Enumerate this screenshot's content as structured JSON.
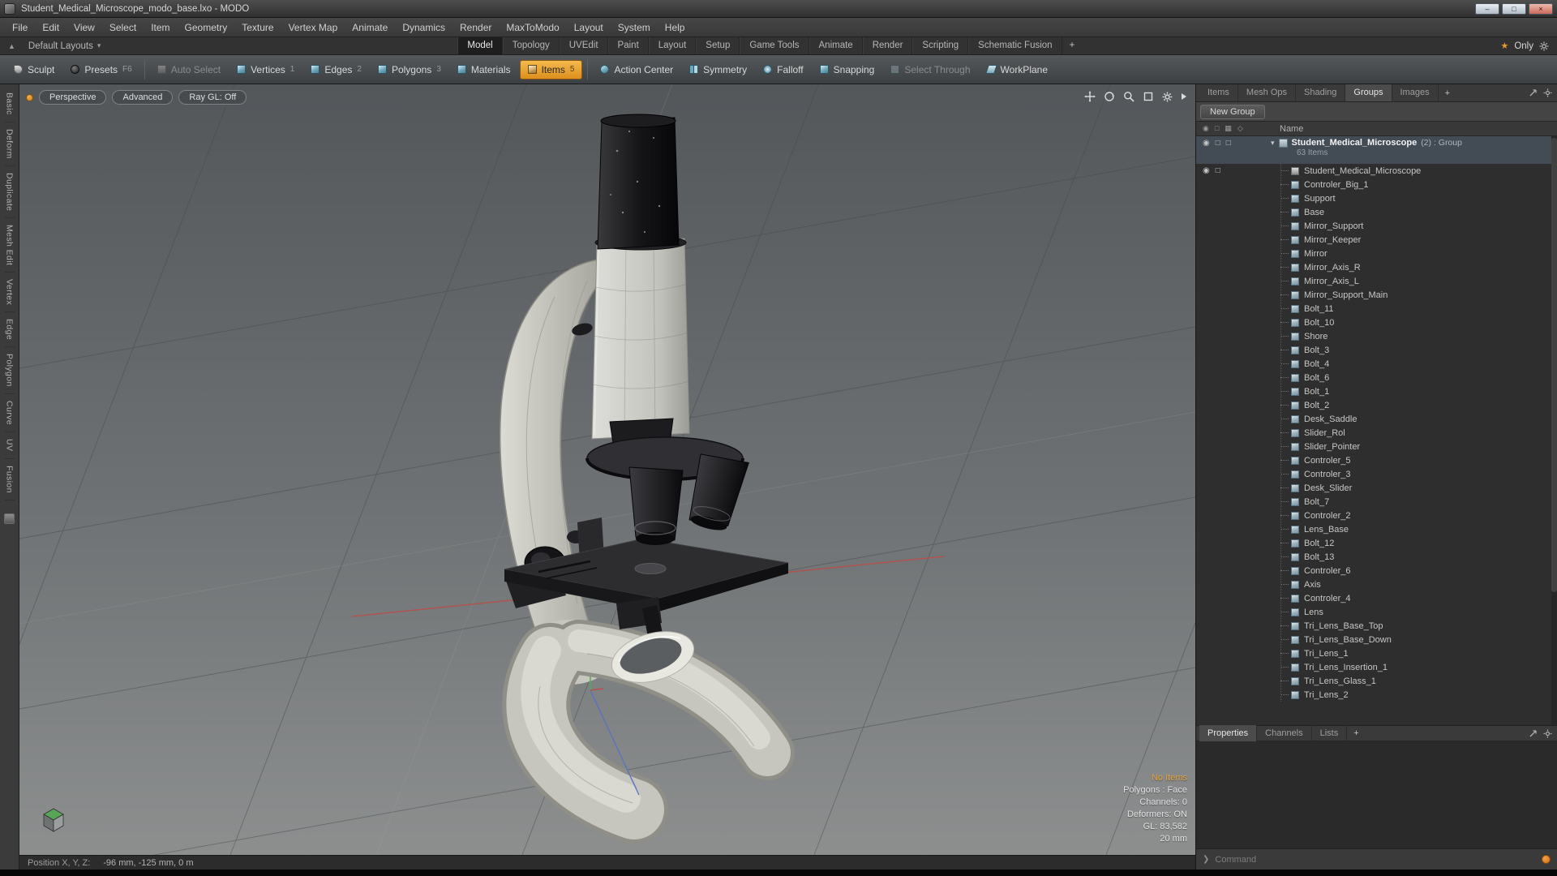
{
  "window": {
    "title": "Student_Medical_Microscope_modo_base.lxo - MODO",
    "controls": {
      "minimize": "–",
      "maximize": "□",
      "close": "×"
    }
  },
  "menu_bar": {
    "items": [
      {
        "label": "File"
      },
      {
        "label": "Edit"
      },
      {
        "label": "View"
      },
      {
        "label": "Select"
      },
      {
        "label": "Item"
      },
      {
        "label": "Geometry"
      },
      {
        "label": "Texture"
      },
      {
        "label": "Vertex Map"
      },
      {
        "label": "Animate"
      },
      {
        "label": "Dynamics"
      },
      {
        "label": "Render"
      },
      {
        "label": "MaxToModo"
      },
      {
        "label": "Layout"
      },
      {
        "label": "System"
      },
      {
        "label": "Help"
      }
    ]
  },
  "layout_bar": {
    "dock_icon": "▲",
    "layout_switcher": "Default Layouts",
    "caret": "▾",
    "tabs": [
      {
        "label": "Model",
        "active": true
      },
      {
        "label": "Topology"
      },
      {
        "label": "UVEdit"
      },
      {
        "label": "Paint"
      },
      {
        "label": "Layout"
      },
      {
        "label": "Setup"
      },
      {
        "label": "Game Tools"
      },
      {
        "label": "Animate"
      },
      {
        "label": "Render"
      },
      {
        "label": "Scripting"
      },
      {
        "label": "Schematic Fusion"
      }
    ],
    "add_tab": "+",
    "only_toggle": {
      "star": "★",
      "label": "Only"
    }
  },
  "toolbar": {
    "group1": [
      {
        "label": "Sculpt",
        "icon": "sculpt"
      },
      {
        "label": "Presets",
        "key": "F6",
        "icon": "presets"
      }
    ],
    "group2": [
      {
        "label": "Auto Select",
        "icon": "auto-select",
        "disabled": true
      },
      {
        "label": "Vertices",
        "key": "1",
        "icon": "vertices"
      },
      {
        "label": "Edges",
        "key": "2",
        "icon": "edges"
      },
      {
        "label": "Polygons",
        "key": "3",
        "icon": "polygons"
      },
      {
        "label": "Materials",
        "icon": "materials"
      },
      {
        "label": "Items",
        "key": "5",
        "icon": "items",
        "active": true
      }
    ],
    "group3": [
      {
        "label": "Action Center",
        "icon": "action-center"
      },
      {
        "label": "Symmetry",
        "icon": "symmetry"
      },
      {
        "label": "Falloff",
        "icon": "falloff"
      },
      {
        "label": "Snapping",
        "icon": "snapping"
      },
      {
        "label": "Select Through",
        "icon": "select-through",
        "disabled": true
      },
      {
        "label": "WorkPlane",
        "icon": "workplane"
      }
    ]
  },
  "tool_palette": {
    "tabs": [
      {
        "label": "Basic"
      },
      {
        "label": "Deform"
      },
      {
        "label": "Duplicate"
      },
      {
        "label": "Mesh Edit"
      },
      {
        "label": "Vertex"
      },
      {
        "label": "Edge"
      },
      {
        "label": "Polygon"
      },
      {
        "label": "Curve"
      },
      {
        "label": "UV"
      },
      {
        "label": "Fusion"
      }
    ]
  },
  "viewport": {
    "controls": [
      {
        "label": "Perspective"
      },
      {
        "label": "Advanced"
      },
      {
        "label": "Ray GL: Off"
      }
    ],
    "stats": {
      "selection": "No Items",
      "lines": [
        {
          "text": "Polygons : Face"
        },
        {
          "text": "Channels: 0"
        },
        {
          "text": "Deformers: ON"
        },
        {
          "text": "GL: 83,582"
        },
        {
          "text": "20 mm"
        }
      ]
    }
  },
  "groups_panel": {
    "tabs": [
      {
        "label": "Items"
      },
      {
        "label": "Mesh Ops"
      },
      {
        "label": "Shading"
      },
      {
        "label": "Groups",
        "active": true
      },
      {
        "label": "Images"
      }
    ],
    "add_tab": "+",
    "new_group_button": "New Group",
    "columns": {
      "name": "Name"
    },
    "column_icons": {
      "visible": "◉",
      "render": "□",
      "lock": "▦",
      "filter": "◇"
    },
    "group": {
      "expander": "▾",
      "name": "Student_Medical_Microscope",
      "meta": "(2) : Group",
      "count": "63 Items",
      "eye": "◉",
      "box1": "□",
      "box2": "□"
    },
    "first_row_icons": {
      "eye": "◉",
      "box": "□"
    },
    "items": [
      {
        "label": "Student_Medical_Microscope",
        "icon": "mesh"
      },
      {
        "label": "Controler_Big_1",
        "icon": "item"
      },
      {
        "label": "Support",
        "icon": "item"
      },
      {
        "label": "Base",
        "icon": "item"
      },
      {
        "label": "Mirror_Support",
        "icon": "item"
      },
      {
        "label": "Mirror_Keeper",
        "icon": "item"
      },
      {
        "label": "Mirror",
        "icon": "item"
      },
      {
        "label": "Mirror_Axis_R",
        "icon": "item"
      },
      {
        "label": "Mirror_Axis_L",
        "icon": "item"
      },
      {
        "label": "Mirror_Support_Main",
        "icon": "item"
      },
      {
        "label": "Bolt_11",
        "icon": "item"
      },
      {
        "label": "Bolt_10",
        "icon": "item"
      },
      {
        "label": "Shore",
        "icon": "item"
      },
      {
        "label": "Bolt_3",
        "icon": "item"
      },
      {
        "label": "Bolt_4",
        "icon": "item"
      },
      {
        "label": "Bolt_6",
        "icon": "item"
      },
      {
        "label": "Bolt_1",
        "icon": "item"
      },
      {
        "label": "Bolt_2",
        "icon": "item"
      },
      {
        "label": "Desk_Saddle",
        "icon": "item"
      },
      {
        "label": "Slider_Rol",
        "icon": "item"
      },
      {
        "label": "Slider_Pointer",
        "icon": "item"
      },
      {
        "label": "Controler_5",
        "icon": "item"
      },
      {
        "label": "Controler_3",
        "icon": "item"
      },
      {
        "label": "Desk_Slider",
        "icon": "item"
      },
      {
        "label": "Bolt_7",
        "icon": "item"
      },
      {
        "label": "Controler_2",
        "icon": "item"
      },
      {
        "label": "Lens_Base",
        "icon": "item"
      },
      {
        "label": "Bolt_12",
        "icon": "item"
      },
      {
        "label": "Bolt_13",
        "icon": "item"
      },
      {
        "label": "Controler_6",
        "icon": "item"
      },
      {
        "label": "Axis",
        "icon": "item"
      },
      {
        "label": "Controler_4",
        "icon": "item"
      },
      {
        "label": "Lens",
        "icon": "item"
      },
      {
        "label": "Tri_Lens_Base_Top",
        "icon": "item"
      },
      {
        "label": "Tri_Lens_Base_Down",
        "icon": "item"
      },
      {
        "label": "Tri_Lens_1",
        "icon": "item"
      },
      {
        "label": "Tri_Lens_Insertion_1",
        "icon": "item"
      },
      {
        "label": "Tri_Lens_Glass_1",
        "icon": "item"
      },
      {
        "label": "Tri_Lens_2",
        "icon": "item"
      }
    ]
  },
  "properties_panel": {
    "tabs": [
      {
        "label": "Properties",
        "active": true
      },
      {
        "label": "Channels"
      },
      {
        "label": "Lists"
      }
    ],
    "add_tab": "+"
  },
  "command_bar": {
    "prompt": "❯",
    "placeholder": "Command"
  },
  "status_bar": {
    "label": "Position X, Y, Z:",
    "value": "-96 mm, -125 mm, 0 m"
  },
  "colors": {
    "accent_orange": "#e29a2f",
    "items_button_orange": "#e39b2d",
    "selection_row": "#434b54",
    "axis_red": "#b3524d",
    "axis_blue": "#5d73c0"
  }
}
